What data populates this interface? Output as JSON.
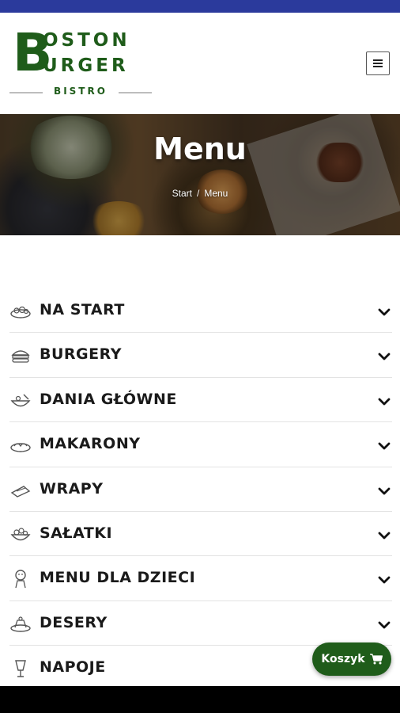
{
  "colors": {
    "top_bar": "#2b3a9c",
    "brand_green": "#1f5c1a",
    "divider": "#e3e3e3"
  },
  "logo": {
    "big_letter": "B",
    "line1": "OSTON",
    "line2": "URGER",
    "subtitle": "BISTRO"
  },
  "header": {
    "menu_toggle_icon": "hamburger-icon"
  },
  "hero": {
    "title": "Menu",
    "breadcrumb": {
      "home": "Start",
      "separator": "/",
      "current": "Menu"
    }
  },
  "categories": [
    {
      "label": "NA START",
      "icon": "appetizer-icon"
    },
    {
      "label": "BURGERY",
      "icon": "burger-icon"
    },
    {
      "label": "DANIA GŁÓWNE",
      "icon": "main-dish-icon"
    },
    {
      "label": "MAKARONY",
      "icon": "pasta-icon"
    },
    {
      "label": "WRAPY",
      "icon": "wrap-icon"
    },
    {
      "label": "SAŁATKI",
      "icon": "salad-icon"
    },
    {
      "label": "MENU DLA DZIECI",
      "icon": "kids-icon"
    },
    {
      "label": "DESERY",
      "icon": "dessert-icon"
    },
    {
      "label": "NAPOJE",
      "icon": "drink-icon"
    }
  ],
  "cart": {
    "label": "Koszyk",
    "icon": "cart-icon"
  }
}
